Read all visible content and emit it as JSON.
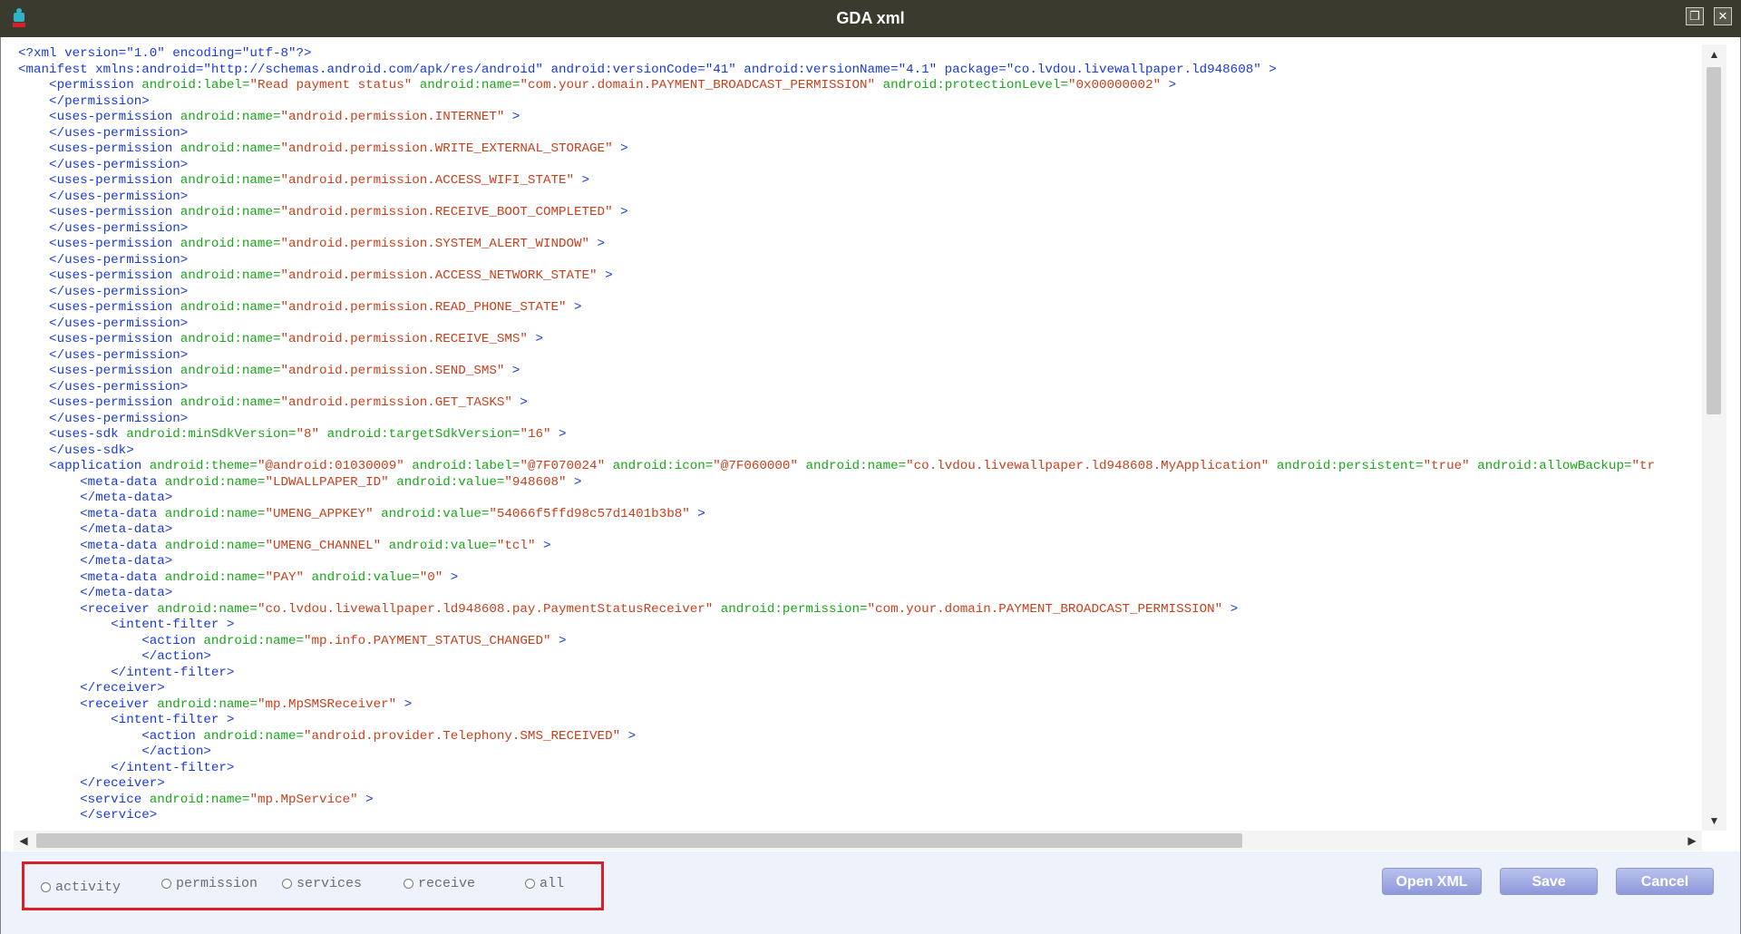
{
  "window": {
    "title": "GDA xml"
  },
  "icons": {
    "app": "android-app-icon",
    "maximize": "restore-icon",
    "close": "close-icon"
  },
  "colors": {
    "tag": "#1a3ad6",
    "attr": "#1aa61a",
    "value": "#c8401c",
    "highlight_border": "#d8202a",
    "button": "#a3acea"
  },
  "xml_lines": [
    [
      {
        "t": "<?xml version=\"1.0\" encoding=\"utf-8\"?>",
        "c": "tag"
      }
    ],
    [
      {
        "t": "<manifest xmlns:android=\"http://schemas.android.com/apk/res/android\" android:versionCode=\"41\" android:versionName=\"4.1\" package=\"co.lvdou.livewallpaper.ld948608\" >",
        "c": "tag"
      }
    ],
    [
      {
        "t": "    <permission ",
        "c": "tag"
      },
      {
        "t": "android:label=",
        "c": "at"
      },
      {
        "t": "\"Read payment status\"",
        "c": "v"
      },
      {
        "t": " android:name=",
        "c": "at"
      },
      {
        "t": "\"com.your.domain.PAYMENT_BROADCAST_PERMISSION\"",
        "c": "v"
      },
      {
        "t": " android:protectionLevel=",
        "c": "at"
      },
      {
        "t": "\"0x00000002\"",
        "c": "v"
      },
      {
        "t": " >",
        "c": "tag"
      }
    ],
    [
      {
        "t": "    </permission>",
        "c": "tag"
      }
    ],
    [
      {
        "t": "    <uses-permission ",
        "c": "tag"
      },
      {
        "t": "android:name=",
        "c": "at"
      },
      {
        "t": "\"android.permission.INTERNET\"",
        "c": "v"
      },
      {
        "t": " >",
        "c": "tag"
      }
    ],
    [
      {
        "t": "    </uses-permission>",
        "c": "tag"
      }
    ],
    [
      {
        "t": "    <uses-permission ",
        "c": "tag"
      },
      {
        "t": "android:name=",
        "c": "at"
      },
      {
        "t": "\"android.permission.WRITE_EXTERNAL_STORAGE\"",
        "c": "v"
      },
      {
        "t": " >",
        "c": "tag"
      }
    ],
    [
      {
        "t": "    </uses-permission>",
        "c": "tag"
      }
    ],
    [
      {
        "t": "    <uses-permission ",
        "c": "tag"
      },
      {
        "t": "android:name=",
        "c": "at"
      },
      {
        "t": "\"android.permission.ACCESS_WIFI_STATE\"",
        "c": "v"
      },
      {
        "t": " >",
        "c": "tag"
      }
    ],
    [
      {
        "t": "    </uses-permission>",
        "c": "tag"
      }
    ],
    [
      {
        "t": "    <uses-permission ",
        "c": "tag"
      },
      {
        "t": "android:name=",
        "c": "at"
      },
      {
        "t": "\"android.permission.RECEIVE_BOOT_COMPLETED\"",
        "c": "v"
      },
      {
        "t": " >",
        "c": "tag"
      }
    ],
    [
      {
        "t": "    </uses-permission>",
        "c": "tag"
      }
    ],
    [
      {
        "t": "    <uses-permission ",
        "c": "tag"
      },
      {
        "t": "android:name=",
        "c": "at"
      },
      {
        "t": "\"android.permission.SYSTEM_ALERT_WINDOW\"",
        "c": "v"
      },
      {
        "t": " >",
        "c": "tag"
      }
    ],
    [
      {
        "t": "    </uses-permission>",
        "c": "tag"
      }
    ],
    [
      {
        "t": "    <uses-permission ",
        "c": "tag"
      },
      {
        "t": "android:name=",
        "c": "at"
      },
      {
        "t": "\"android.permission.ACCESS_NETWORK_STATE\"",
        "c": "v"
      },
      {
        "t": " >",
        "c": "tag"
      }
    ],
    [
      {
        "t": "    </uses-permission>",
        "c": "tag"
      }
    ],
    [
      {
        "t": "    <uses-permission ",
        "c": "tag"
      },
      {
        "t": "android:name=",
        "c": "at"
      },
      {
        "t": "\"android.permission.READ_PHONE_STATE\"",
        "c": "v"
      },
      {
        "t": " >",
        "c": "tag"
      }
    ],
    [
      {
        "t": "    </uses-permission>",
        "c": "tag"
      }
    ],
    [
      {
        "t": "    <uses-permission ",
        "c": "tag"
      },
      {
        "t": "android:name=",
        "c": "at"
      },
      {
        "t": "\"android.permission.RECEIVE_SMS\"",
        "c": "v"
      },
      {
        "t": " >",
        "c": "tag"
      }
    ],
    [
      {
        "t": "    </uses-permission>",
        "c": "tag"
      }
    ],
    [
      {
        "t": "    <uses-permission ",
        "c": "tag"
      },
      {
        "t": "android:name=",
        "c": "at"
      },
      {
        "t": "\"android.permission.SEND_SMS\"",
        "c": "v"
      },
      {
        "t": " >",
        "c": "tag"
      }
    ],
    [
      {
        "t": "    </uses-permission>",
        "c": "tag"
      }
    ],
    [
      {
        "t": "    <uses-permission ",
        "c": "tag"
      },
      {
        "t": "android:name=",
        "c": "at"
      },
      {
        "t": "\"android.permission.GET_TASKS\"",
        "c": "v"
      },
      {
        "t": " >",
        "c": "tag"
      }
    ],
    [
      {
        "t": "    </uses-permission>",
        "c": "tag"
      }
    ],
    [
      {
        "t": "    <uses-sdk ",
        "c": "tag"
      },
      {
        "t": "android:minSdkVersion=",
        "c": "at"
      },
      {
        "t": "\"8\"",
        "c": "v"
      },
      {
        "t": " android:targetSdkVersion=",
        "c": "at"
      },
      {
        "t": "\"16\"",
        "c": "v"
      },
      {
        "t": " >",
        "c": "tag"
      }
    ],
    [
      {
        "t": "    </uses-sdk>",
        "c": "tag"
      }
    ],
    [
      {
        "t": "    <application ",
        "c": "tag"
      },
      {
        "t": "android:theme=",
        "c": "at"
      },
      {
        "t": "\"@android:01030009\"",
        "c": "v"
      },
      {
        "t": " android:label=",
        "c": "at"
      },
      {
        "t": "\"@7F070024\"",
        "c": "v"
      },
      {
        "t": " android:icon=",
        "c": "at"
      },
      {
        "t": "\"@7F060000\"",
        "c": "v"
      },
      {
        "t": " android:name=",
        "c": "at"
      },
      {
        "t": "\"co.lvdou.livewallpaper.ld948608.MyApplication\"",
        "c": "v"
      },
      {
        "t": " android:persistent=",
        "c": "at"
      },
      {
        "t": "\"true\"",
        "c": "v"
      },
      {
        "t": " android:allowBackup=",
        "c": "at"
      },
      {
        "t": "\"tr",
        "c": "v"
      }
    ],
    [
      {
        "t": "        <meta-data ",
        "c": "tag"
      },
      {
        "t": "android:name=",
        "c": "at"
      },
      {
        "t": "\"LDWALLPAPER_ID\"",
        "c": "v"
      },
      {
        "t": " android:value=",
        "c": "at"
      },
      {
        "t": "\"948608\"",
        "c": "v"
      },
      {
        "t": " >",
        "c": "tag"
      }
    ],
    [
      {
        "t": "        </meta-data>",
        "c": "tag"
      }
    ],
    [
      {
        "t": "        <meta-data ",
        "c": "tag"
      },
      {
        "t": "android:name=",
        "c": "at"
      },
      {
        "t": "\"UMENG_APPKEY\"",
        "c": "v"
      },
      {
        "t": " android:value=",
        "c": "at"
      },
      {
        "t": "\"54066f5ffd98c57d1401b3b8\"",
        "c": "v"
      },
      {
        "t": " >",
        "c": "tag"
      }
    ],
    [
      {
        "t": "        </meta-data>",
        "c": "tag"
      }
    ],
    [
      {
        "t": "        <meta-data ",
        "c": "tag"
      },
      {
        "t": "android:name=",
        "c": "at"
      },
      {
        "t": "\"UMENG_CHANNEL\"",
        "c": "v"
      },
      {
        "t": " android:value=",
        "c": "at"
      },
      {
        "t": "\"tcl\"",
        "c": "v"
      },
      {
        "t": " >",
        "c": "tag"
      }
    ],
    [
      {
        "t": "        </meta-data>",
        "c": "tag"
      }
    ],
    [
      {
        "t": "        <meta-data ",
        "c": "tag"
      },
      {
        "t": "android:name=",
        "c": "at"
      },
      {
        "t": "\"PAY\"",
        "c": "v"
      },
      {
        "t": " android:value=",
        "c": "at"
      },
      {
        "t": "\"0\"",
        "c": "v"
      },
      {
        "t": " >",
        "c": "tag"
      }
    ],
    [
      {
        "t": "        </meta-data>",
        "c": "tag"
      }
    ],
    [
      {
        "t": "        <receiver ",
        "c": "tag"
      },
      {
        "t": "android:name=",
        "c": "at"
      },
      {
        "t": "\"co.lvdou.livewallpaper.ld948608.pay.PaymentStatusReceiver\"",
        "c": "v"
      },
      {
        "t": " android:permission=",
        "c": "at"
      },
      {
        "t": "\"com.your.domain.PAYMENT_BROADCAST_PERMISSION\"",
        "c": "v"
      },
      {
        "t": " >",
        "c": "tag"
      }
    ],
    [
      {
        "t": "            <intent-filter >",
        "c": "tag"
      }
    ],
    [
      {
        "t": "                <action ",
        "c": "tag"
      },
      {
        "t": "android:name=",
        "c": "at"
      },
      {
        "t": "\"mp.info.PAYMENT_STATUS_CHANGED\"",
        "c": "v"
      },
      {
        "t": " >",
        "c": "tag"
      }
    ],
    [
      {
        "t": "                </action>",
        "c": "tag"
      }
    ],
    [
      {
        "t": "            </intent-filter>",
        "c": "tag"
      }
    ],
    [
      {
        "t": "        </receiver>",
        "c": "tag"
      }
    ],
    [
      {
        "t": "        <receiver ",
        "c": "tag"
      },
      {
        "t": "android:name=",
        "c": "at"
      },
      {
        "t": "\"mp.MpSMSReceiver\"",
        "c": "v"
      },
      {
        "t": " >",
        "c": "tag"
      }
    ],
    [
      {
        "t": "            <intent-filter >",
        "c": "tag"
      }
    ],
    [
      {
        "t": "                <action ",
        "c": "tag"
      },
      {
        "t": "android:name=",
        "c": "at"
      },
      {
        "t": "\"android.provider.Telephony.SMS_RECEIVED\"",
        "c": "v"
      },
      {
        "t": " >",
        "c": "tag"
      }
    ],
    [
      {
        "t": "                </action>",
        "c": "tag"
      }
    ],
    [
      {
        "t": "            </intent-filter>",
        "c": "tag"
      }
    ],
    [
      {
        "t": "        </receiver>",
        "c": "tag"
      }
    ],
    [
      {
        "t": "        <service ",
        "c": "tag"
      },
      {
        "t": "android:name=",
        "c": "at"
      },
      {
        "t": "\"mp.MpService\"",
        "c": "v"
      },
      {
        "t": " >",
        "c": "tag"
      }
    ],
    [
      {
        "t": "        </service>",
        "c": "tag"
      }
    ]
  ],
  "filters": {
    "options": [
      {
        "label": "activity"
      },
      {
        "label": "permission"
      },
      {
        "label": "services"
      },
      {
        "label": "receive"
      },
      {
        "label": "all"
      }
    ],
    "selected": null
  },
  "buttons": {
    "open_xml": "Open XML",
    "save": "Save",
    "cancel": "Cancel"
  }
}
